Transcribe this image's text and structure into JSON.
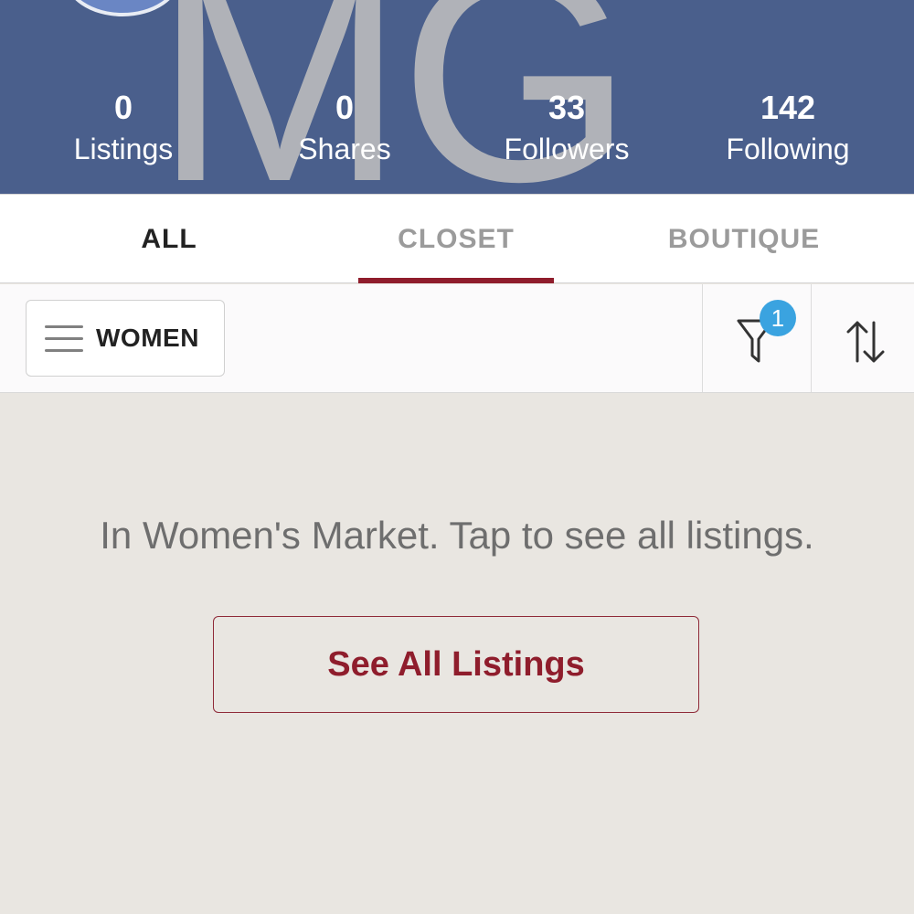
{
  "profile": {
    "initials": "MG",
    "stats": [
      {
        "value": "0",
        "label": "Listings"
      },
      {
        "value": "0",
        "label": "Shares"
      },
      {
        "value": "33",
        "label": "Followers"
      },
      {
        "value": "142",
        "label": "Following"
      }
    ]
  },
  "tabs": [
    {
      "label": "ALL"
    },
    {
      "label": "CLOSET",
      "selected": true
    },
    {
      "label": "BOUTIQUE"
    }
  ],
  "filterbar": {
    "department_label": "WOMEN",
    "filter_count": "1",
    "icons": [
      "menu-icon",
      "filter-icon",
      "sort-icon"
    ]
  },
  "content": {
    "message": "In Women's Market. Tap to see all listings.",
    "button_label": "See All Listings"
  },
  "colors": {
    "header_bg": "#4a5f8c",
    "accent": "#8f1d2c",
    "badge": "#3aa3e0",
    "page_bg": "#e9e6e1"
  }
}
